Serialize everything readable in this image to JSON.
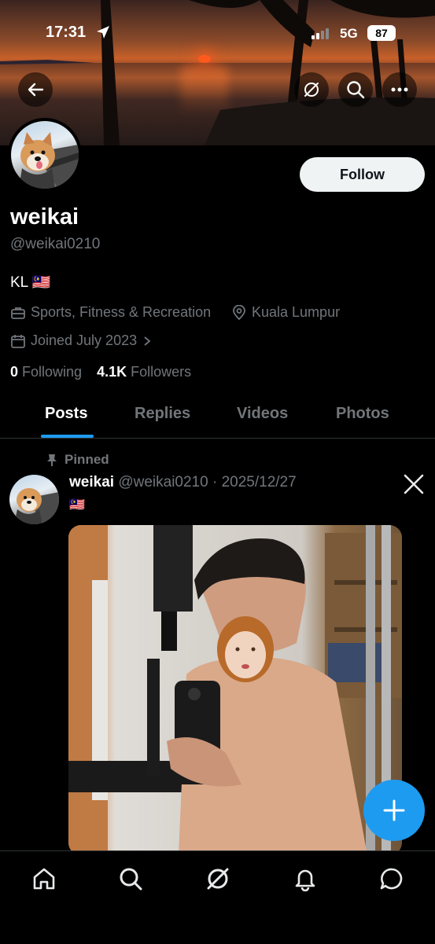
{
  "status_bar": {
    "time": "17:31",
    "network": "5G",
    "battery": "87"
  },
  "profile": {
    "display_name": "weikai",
    "handle": "@weikai0210",
    "bio": "KL 🇲🇾",
    "category": "Sports, Fitness & Recreation",
    "location": "Kuala Lumpur",
    "joined": "Joined July 2023",
    "following_count": "0",
    "following_label": "Following",
    "followers_count": "4.1K",
    "followers_label": "Followers",
    "follow_button": "Follow"
  },
  "tabs": [
    {
      "label": "Posts",
      "active": true
    },
    {
      "label": "Replies",
      "active": false
    },
    {
      "label": "Videos",
      "active": false
    },
    {
      "label": "Photos",
      "active": false
    }
  ],
  "post": {
    "pinned_label": "Pinned",
    "author_name": "weikai",
    "author_handle": "@weikai0210",
    "date": "· 2025/12/27",
    "flag": "🇲🇾"
  },
  "icons": {
    "back": "arrow-left-icon",
    "grok": "grok-icon",
    "search": "search-icon",
    "more": "more-icon",
    "x_logo": "x-logo-icon",
    "compose": "plus-icon"
  },
  "colors": {
    "accent": "#1d9bf0",
    "muted": "#71767b",
    "background": "#000000"
  }
}
